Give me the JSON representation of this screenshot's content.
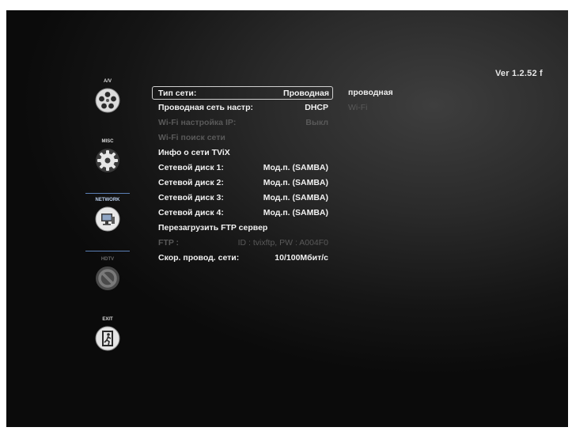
{
  "version": "Ver 1.2.52 f",
  "sidebar": {
    "items": [
      {
        "label": "A/V",
        "icon": "film-reel-icon"
      },
      {
        "label": "MISC",
        "icon": "gear-icon"
      },
      {
        "label": "NETWORK",
        "icon": "network-icon",
        "selected": true
      },
      {
        "label": "HDTV",
        "icon": "disabled-icon",
        "dimmed": true
      },
      {
        "label": "EXIT",
        "icon": "exit-icon"
      }
    ]
  },
  "menu": {
    "rows": [
      {
        "label": "Тип сети:",
        "value": "Проводная",
        "selected": true
      },
      {
        "label": "Проводная сеть настр:",
        "value": "DHCP"
      },
      {
        "label": "Wi-Fi настройка IP:",
        "value": "Выкл",
        "dimmed": true
      },
      {
        "label": "Wi-Fi поиск сети",
        "value": "",
        "dimmed": true
      },
      {
        "label": "Инфо о сети TViX",
        "value": ""
      },
      {
        "label": "Сетевой диск 1:",
        "value": "Мод.п. (SAMBA)"
      },
      {
        "label": "Сетевой диск 2:",
        "value": "Мод.п. (SAMBA)"
      },
      {
        "label": "Сетевой диск 3:",
        "value": "Мод.п. (SAMBA)"
      },
      {
        "label": "Сетевой диск 4:",
        "value": "Мод.п. (SAMBA)"
      },
      {
        "label": "Перезагрузить FTP сервер",
        "value": ""
      },
      {
        "label": "FTP :",
        "value": "ID : tvixftp, PW : A004F0",
        "dimmed": true
      },
      {
        "label": "Скор. провод. сети:",
        "value": "10/100Мбит/с"
      }
    ]
  },
  "options": [
    {
      "label": "проводная",
      "dimmed": false
    },
    {
      "label": "Wi-Fi",
      "dimmed": true
    }
  ]
}
